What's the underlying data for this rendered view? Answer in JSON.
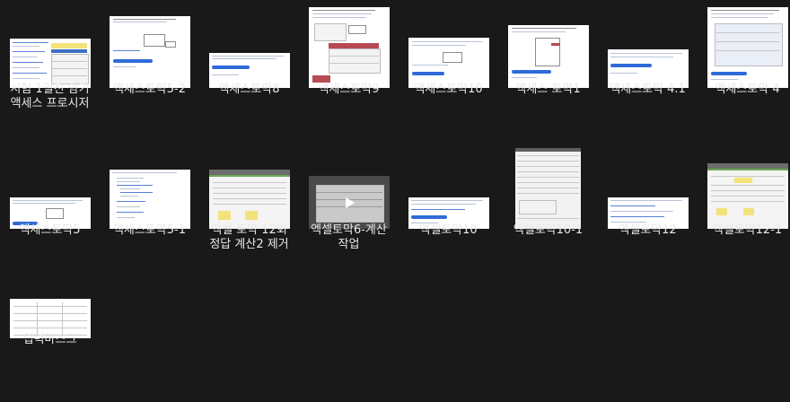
{
  "files": [
    {
      "name": "시험 1일전 암기\n액세스 프로시저",
      "thumb": "tiny-doc-with-table"
    },
    {
      "name": "액세스토막5-2",
      "thumb": "doc-with-dialog"
    },
    {
      "name": "액세스토막8",
      "thumb": "doc-header-lines"
    },
    {
      "name": "액세스토막9",
      "thumb": "doc-with-red-table"
    },
    {
      "name": "액세스토막10",
      "thumb": "doc-with-dialog"
    },
    {
      "name": "액세스 토막1",
      "thumb": "doc-with-list"
    },
    {
      "name": "액세스토막 4.1",
      "thumb": "doc-header-lines"
    },
    {
      "name": "액세스토막 4",
      "thumb": "doc-with-form"
    },
    {
      "name": "액세스토막5",
      "thumb": "doc-with-small-dialog"
    },
    {
      "name": "액세스토막5-1",
      "thumb": "doc-code"
    },
    {
      "name": "엑셀 토막 12회\n정답 계산2 제거",
      "thumb": "spreadsheet"
    },
    {
      "name": "엑셀토막6-계산\n작업",
      "thumb": "video-spreadsheet"
    },
    {
      "name": "엑셀토막10",
      "thumb": "doc-header-lines"
    },
    {
      "name": "엑셀토막10-1",
      "thumb": "tall-spreadsheet"
    },
    {
      "name": "엑셀토막12",
      "thumb": "doc-header-lines"
    },
    {
      "name": "엑셀토막12-1",
      "thumb": "spreadsheet-green"
    },
    {
      "name": "입력마스크",
      "thumb": "small-table"
    }
  ],
  "colors": {
    "background": "#191919",
    "label": "#e9e9e9",
    "thumb_accent": "#2f6bd8"
  }
}
